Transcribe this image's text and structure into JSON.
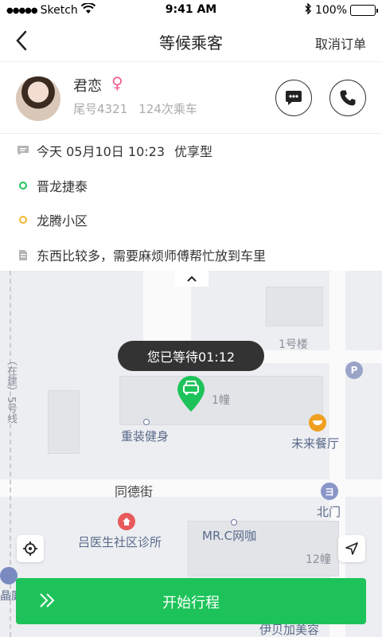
{
  "status_bar": {
    "carrier": "Sketch",
    "time": "9:41 AM",
    "battery": "100%"
  },
  "header": {
    "title": "等候乘客",
    "cancel_label": "取消订单"
  },
  "passenger": {
    "name": "君恋",
    "gender_symbol": "♀",
    "tail_number": "尾号4321",
    "ride_count": "124次乘车"
  },
  "trip": {
    "datetime": "今天 05月10日 10:23",
    "service_type": "优享型",
    "pickup": "晋龙捷泰",
    "dropoff": "龙腾小区",
    "note": "东西比较多，需要麻烦师傅帮忙放到车里"
  },
  "map": {
    "wait_bubble": "您已等待01:12",
    "labels": {
      "building_1": "1号楼",
      "building_1_zhuang": "1幢",
      "gym": "重装健身",
      "restaurant": "未来餐厅",
      "street": "同德街",
      "north_gate": "北门",
      "clinic": "吕医生社区诊所",
      "net_cafe": "MR.C网咖",
      "building_12": "12幢",
      "side_road": "（在建）5号线",
      "bottom_poi": "伊贝加美容",
      "left_poi": "晶庭"
    },
    "poi_icons": {
      "parking": "P",
      "north_gate_icon": "ヨ"
    }
  },
  "actions": {
    "start_trip_label": "开始行程"
  },
  "colors": {
    "accent_green": "#1dc35a",
    "pickup_dot": "#1dc35a",
    "dropoff_dot": "#f5b82e",
    "gender_pink": "#f06090"
  }
}
